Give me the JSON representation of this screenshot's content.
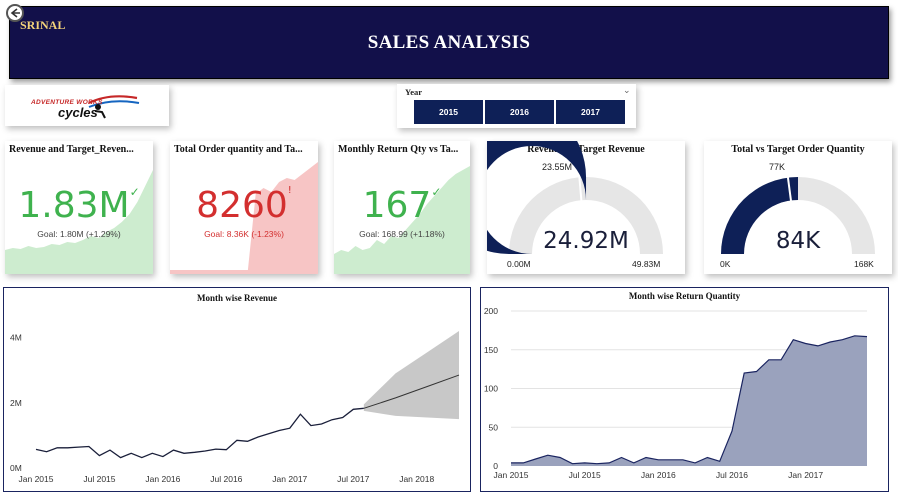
{
  "header": {
    "brand": "SRINAL",
    "title": "SALES ANALYSIS",
    "bg": "#12104a"
  },
  "logo": {
    "line1": "ADVENTURE WORKS",
    "line2": "cycles"
  },
  "year_slicer": {
    "label": "Year",
    "options": [
      "2015",
      "2016",
      "2017"
    ]
  },
  "kpis": [
    {
      "title": "Revenue and Target_Reven...",
      "value": "1.83M",
      "mark": "✓",
      "goal": "Goal: 1.80M (+1.29%)",
      "status": "up",
      "color": "#3fb24e"
    },
    {
      "title": "Total Order quantity and Ta...",
      "value": "8260",
      "mark": "!",
      "goal": "Goal: 8.36K (-1.23%)",
      "status": "down",
      "color": "#d32f2f"
    },
    {
      "title": "Monthly Return Qty vs Ta...",
      "value": "167",
      "mark": "✓",
      "goal": "Goal: 168.99 (+1.18%)",
      "status": "up",
      "color": "#3fb24e"
    }
  ],
  "gauges": [
    {
      "title": "Revenue vs Target Revenue",
      "value": "24.92M",
      "target": "23.55M",
      "min": "0.00M",
      "max": "49.83M",
      "value_num": 24.92,
      "target_num": 23.55,
      "max_num": 49.83
    },
    {
      "title": "Total vs Target Order Quantity",
      "value": "84K",
      "target": "77K",
      "min": "0K",
      "max": "168K",
      "value_num": 84,
      "target_num": 77,
      "max_num": 168
    }
  ],
  "colors": {
    "navy": "#0e2057",
    "gauge_track": "#e6e6e6",
    "area_fill": "#9aa2bd",
    "forecast_band": "#c8c8c8"
  },
  "chart_data": [
    {
      "type": "line",
      "title": "Month wise Revenue",
      "x_ticks": [
        "Jan 2015",
        "Jul 2015",
        "Jan 2016",
        "Jul 2016",
        "Jan 2017",
        "Jul 2017",
        "Jan 2018"
      ],
      "y_ticks": [
        "0M",
        "2M",
        "4M"
      ],
      "ylim": [
        0,
        4.6
      ],
      "xlim": [
        0,
        40
      ],
      "series": [
        {
          "values": [
            0.57,
            0.5,
            0.62,
            0.62,
            0.64,
            0.66,
            0.38,
            0.55,
            0.32,
            0.45,
            0.32,
            0.45,
            0.35,
            0.55,
            0.45,
            0.48,
            0.52,
            0.58,
            0.56,
            0.85,
            0.82,
            0.95,
            1.05,
            1.15,
            1.22,
            1.65,
            1.3,
            1.35,
            1.48,
            1.55,
            1.8,
            1.83
          ]
        }
      ],
      "forecast": {
        "x": [
          31,
          34,
          37,
          40
        ],
        "values": [
          1.83,
          2.15,
          2.5,
          2.85
        ],
        "upper": [
          1.95,
          2.9,
          3.55,
          4.2
        ],
        "lower": [
          1.75,
          1.6,
          1.55,
          1.5
        ]
      }
    },
    {
      "type": "area",
      "title": "Month wise Return Quantity",
      "x_ticks": [
        "Jan 2015",
        "Jul 2015",
        "Jan 2016",
        "Jul 2016",
        "Jan 2017"
      ],
      "y_ticks": [
        "0",
        "50",
        "100",
        "150",
        "200"
      ],
      "ylim": [
        0,
        200
      ],
      "values": [
        4,
        4,
        9,
        14,
        11,
        3,
        4,
        3,
        4,
        11,
        4,
        11,
        8,
        8,
        8,
        4,
        11,
        6,
        45,
        120,
        122,
        137,
        137,
        163,
        158,
        155,
        160,
        163,
        168,
        167
      ]
    }
  ],
  "kpi_trends": [
    [
      1.2,
      1.3,
      1.25,
      1.4,
      1.3,
      1.35,
      1.5,
      1.45,
      1.6,
      1.55,
      1.7,
      1.9,
      1.8,
      2.1,
      2.3,
      2.6,
      3.0,
      3.6,
      4.4,
      5.2
    ],
    [
      0.2,
      0.2,
      0.2,
      0.2,
      0.2,
      0.2,
      0.2,
      0.2,
      0.2,
      0.2,
      0.2,
      4.0,
      4.3,
      4.1,
      4.6,
      4.8,
      4.7,
      5.0,
      5.3,
      5.6
    ],
    [
      1.0,
      1.2,
      1.1,
      1.4,
      1.2,
      1.3,
      1.7,
      1.5,
      1.9,
      1.8,
      2.2,
      2.6,
      3.0,
      3.5,
      3.9,
      4.3,
      4.7,
      5.0,
      5.2,
      5.4
    ]
  ]
}
